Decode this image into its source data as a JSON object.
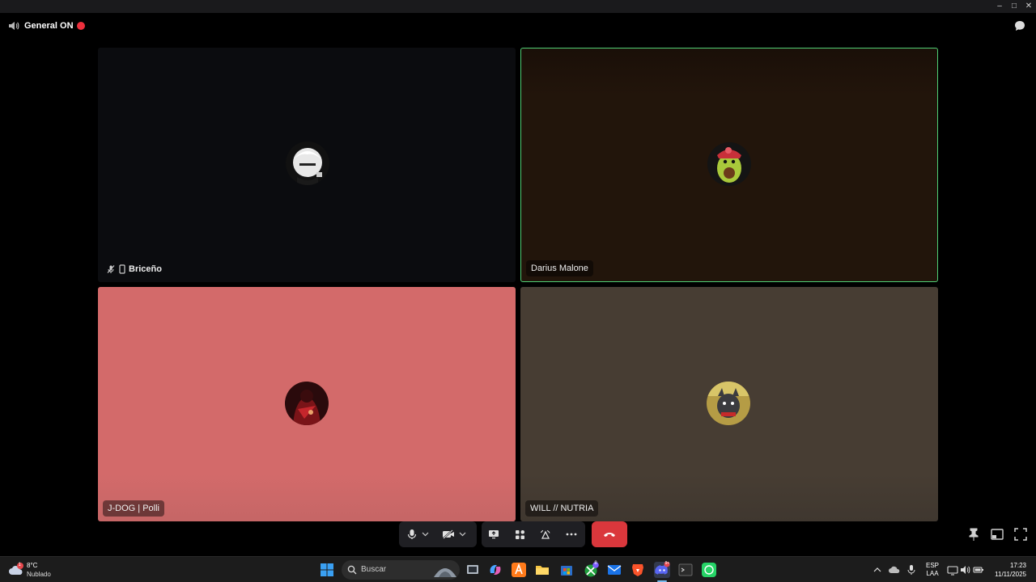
{
  "window": {
    "minimize": "–",
    "maximize": "□",
    "close": "✕"
  },
  "channel": {
    "name": "General ON",
    "live_color": "#ed2f3c"
  },
  "participants": [
    {
      "name": "Briceño",
      "muted": true,
      "mobile": true,
      "speaking": false,
      "tile_color": "#0b0c0f"
    },
    {
      "name": "Darius Malone",
      "speaking": true,
      "tile_color": "#22150b",
      "speaking_color": "#4fcf74"
    },
    {
      "name": "J-DOG | Polli",
      "speaking": false,
      "tile_color": "#d36a6a"
    },
    {
      "name": "WILL // NUTRIA",
      "speaking": false,
      "tile_color": "#473d33"
    }
  ],
  "controls": {
    "microphone": "microphone-icon",
    "camera": "camera-off-icon",
    "screen_share": "screen-share-icon",
    "activities": "activities-icon",
    "soundboard": "soundboard-icon",
    "more": "more-icon",
    "disconnect": "disconnect-icon",
    "disconnect_color": "#da373c"
  },
  "taskbar": {
    "weather": {
      "temp": "8°C",
      "condition": "Nublado",
      "badge": "1"
    },
    "search_placeholder": "Buscar",
    "language": {
      "lang": "ESP",
      "layout": "LAA"
    },
    "time": "17:23",
    "date": "11/11/2025",
    "discord_badge": "9+",
    "xbox_badge": "8"
  }
}
